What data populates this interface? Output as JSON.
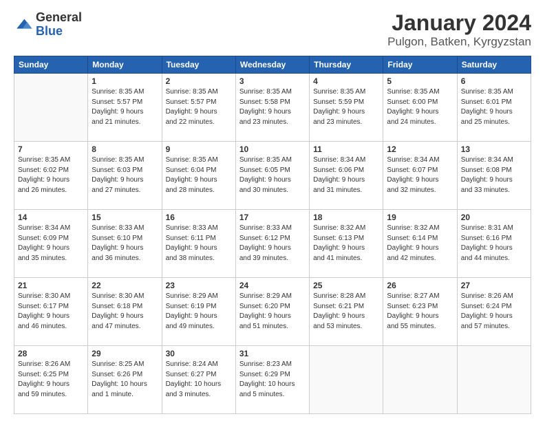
{
  "header": {
    "logo_general": "General",
    "logo_blue": "Blue",
    "title": "January 2024",
    "subtitle": "Pulgon, Batken, Kyrgyzstan"
  },
  "calendar": {
    "days_of_week": [
      "Sunday",
      "Monday",
      "Tuesday",
      "Wednesday",
      "Thursday",
      "Friday",
      "Saturday"
    ],
    "weeks": [
      [
        {
          "day": "",
          "info": ""
        },
        {
          "day": "1",
          "info": "Sunrise: 8:35 AM\nSunset: 5:57 PM\nDaylight: 9 hours\nand 21 minutes."
        },
        {
          "day": "2",
          "info": "Sunrise: 8:35 AM\nSunset: 5:57 PM\nDaylight: 9 hours\nand 22 minutes."
        },
        {
          "day": "3",
          "info": "Sunrise: 8:35 AM\nSunset: 5:58 PM\nDaylight: 9 hours\nand 23 minutes."
        },
        {
          "day": "4",
          "info": "Sunrise: 8:35 AM\nSunset: 5:59 PM\nDaylight: 9 hours\nand 23 minutes."
        },
        {
          "day": "5",
          "info": "Sunrise: 8:35 AM\nSunset: 6:00 PM\nDaylight: 9 hours\nand 24 minutes."
        },
        {
          "day": "6",
          "info": "Sunrise: 8:35 AM\nSunset: 6:01 PM\nDaylight: 9 hours\nand 25 minutes."
        }
      ],
      [
        {
          "day": "7",
          "info": ""
        },
        {
          "day": "8",
          "info": "Sunrise: 8:35 AM\nSunset: 6:03 PM\nDaylight: 9 hours\nand 27 minutes."
        },
        {
          "day": "9",
          "info": "Sunrise: 8:35 AM\nSunset: 6:04 PM\nDaylight: 9 hours\nand 28 minutes."
        },
        {
          "day": "10",
          "info": "Sunrise: 8:35 AM\nSunset: 6:05 PM\nDaylight: 9 hours\nand 30 minutes."
        },
        {
          "day": "11",
          "info": "Sunrise: 8:34 AM\nSunset: 6:06 PM\nDaylight: 9 hours\nand 31 minutes."
        },
        {
          "day": "12",
          "info": "Sunrise: 8:34 AM\nSunset: 6:07 PM\nDaylight: 9 hours\nand 32 minutes."
        },
        {
          "day": "13",
          "info": "Sunrise: 8:34 AM\nSunset: 6:08 PM\nDaylight: 9 hours\nand 33 minutes."
        }
      ],
      [
        {
          "day": "14",
          "info": ""
        },
        {
          "day": "15",
          "info": "Sunrise: 8:33 AM\nSunset: 6:10 PM\nDaylight: 9 hours\nand 36 minutes."
        },
        {
          "day": "16",
          "info": "Sunrise: 8:33 AM\nSunset: 6:11 PM\nDaylight: 9 hours\nand 38 minutes."
        },
        {
          "day": "17",
          "info": "Sunrise: 8:33 AM\nSunset: 6:12 PM\nDaylight: 9 hours\nand 39 minutes."
        },
        {
          "day": "18",
          "info": "Sunrise: 8:32 AM\nSunset: 6:13 PM\nDaylight: 9 hours\nand 41 minutes."
        },
        {
          "day": "19",
          "info": "Sunrise: 8:32 AM\nSunset: 6:14 PM\nDaylight: 9 hours\nand 42 minutes."
        },
        {
          "day": "20",
          "info": "Sunrise: 8:31 AM\nSunset: 6:16 PM\nDaylight: 9 hours\nand 44 minutes."
        }
      ],
      [
        {
          "day": "21",
          "info": ""
        },
        {
          "day": "22",
          "info": "Sunrise: 8:30 AM\nSunset: 6:18 PM\nDaylight: 9 hours\nand 47 minutes."
        },
        {
          "day": "23",
          "info": "Sunrise: 8:29 AM\nSunset: 6:19 PM\nDaylight: 9 hours\nand 49 minutes."
        },
        {
          "day": "24",
          "info": "Sunrise: 8:29 AM\nSunset: 6:20 PM\nDaylight: 9 hours\nand 51 minutes."
        },
        {
          "day": "25",
          "info": "Sunrise: 8:28 AM\nSunset: 6:21 PM\nDaylight: 9 hours\nand 53 minutes."
        },
        {
          "day": "26",
          "info": "Sunrise: 8:27 AM\nSunset: 6:23 PM\nDaylight: 9 hours\nand 55 minutes."
        },
        {
          "day": "27",
          "info": "Sunrise: 8:26 AM\nSunset: 6:24 PM\nDaylight: 9 hours\nand 57 minutes."
        }
      ],
      [
        {
          "day": "28",
          "info": "Sunrise: 8:26 AM\nSunset: 6:25 PM\nDaylight: 9 hours\nand 59 minutes."
        },
        {
          "day": "29",
          "info": "Sunrise: 8:25 AM\nSunset: 6:26 PM\nDaylight: 10 hours\nand 1 minute."
        },
        {
          "day": "30",
          "info": "Sunrise: 8:24 AM\nSunset: 6:27 PM\nDaylight: 10 hours\nand 3 minutes."
        },
        {
          "day": "31",
          "info": "Sunrise: 8:23 AM\nSunset: 6:29 PM\nDaylight: 10 hours\nand 5 minutes."
        },
        {
          "day": "",
          "info": ""
        },
        {
          "day": "",
          "info": ""
        },
        {
          "day": "",
          "info": ""
        }
      ]
    ],
    "week7_sunday": "Sunrise: 8:35 AM\nSunset: 6:02 PM\nDaylight: 9 hours\nand 26 minutes.",
    "week14_sunday": "Sunrise: 8:34 AM\nSunset: 6:09 PM\nDaylight: 9 hours\nand 35 minutes.",
    "week21_sunday": "Sunrise: 8:30 AM\nSunset: 6:17 PM\nDaylight: 9 hours\nand 46 minutes."
  }
}
